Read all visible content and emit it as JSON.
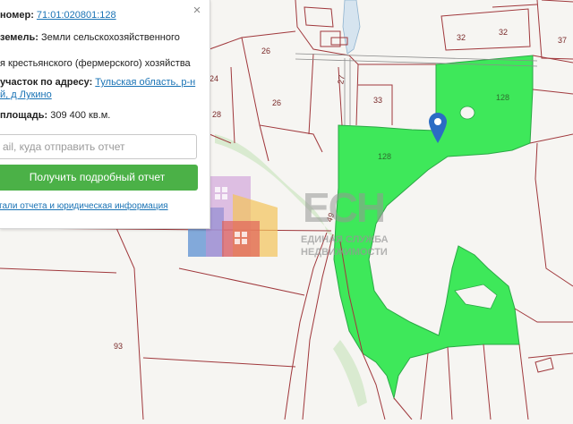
{
  "panel": {
    "cadastral_label": "номер:",
    "cadastral_value": "71:01:020801:128",
    "land_category_label": "земель:",
    "land_category_value_1": "Земли сельскохозяйственного",
    "permitted_use_value": "я крестьянского (фермерского) хозяйства",
    "address_label": "участок по адресу:",
    "address_value_1": "Тульская область, р-н",
    "address_value_2": "й, д Лукино",
    "area_label": "площадь:",
    "area_value": "309 400 кв.м.",
    "email_placeholder": "ail, куда отправить отчет",
    "report_button": "Получить подробный отчет",
    "details_link": "тали отчета и юридическая информация",
    "close_symbol": "×"
  },
  "map": {
    "parcel_labels": [
      "32",
      "32",
      "37",
      "26",
      "24",
      "27",
      "33",
      "128",
      "26",
      "28",
      "128",
      "93",
      "49"
    ],
    "highlight_color": "#3ee85a",
    "boundary_color": "#a0383c"
  },
  "watermark": {
    "logo_title": "ЕСН",
    "logo_subtitle_1": "ЕДИНАЯ СЛУЖБА",
    "logo_subtitle_2": "НЕДВИЖИМОСТИ"
  }
}
